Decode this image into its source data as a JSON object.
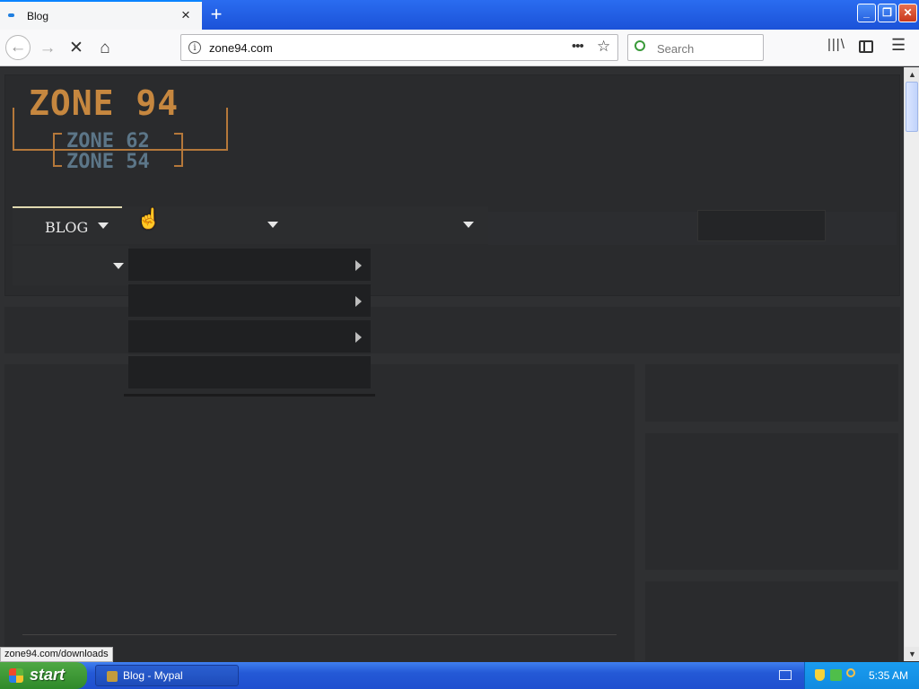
{
  "browser": {
    "tab_title": "Blog",
    "new_tab_symbol": "+",
    "close_tab_symbol": "×",
    "url": "zone94.com",
    "url_info_symbol": "i",
    "url_more_symbol": "•••",
    "bookmark_symbol": "☆",
    "search_placeholder": "Search",
    "library_symbol": "|||\\",
    "menu_symbol": "☰",
    "nav": {
      "back": "←",
      "forward": "→",
      "stop": "✕",
      "home": "⌂"
    },
    "window_controls": {
      "minimize": "_",
      "maximize": "❐",
      "close": "✕"
    }
  },
  "site": {
    "logo": {
      "main": "ZONE 94",
      "sub1": "ZONE 62",
      "sub2": "ZONE 54"
    },
    "nav": {
      "blog_label": "BLOG"
    }
  },
  "status_url": "zone94.com/downloads",
  "scrollbar": {
    "up": "▲",
    "down": "▼"
  },
  "taskbar": {
    "start_label": "start",
    "task_label": "Blog - Mypal",
    "clock": "5:35 AM"
  },
  "colors": {
    "page_bg": "#2f3032",
    "logo_orange": "#c6873f",
    "logo_steel": "#5c7688",
    "taskbar_blue": "#2459d6",
    "start_green": "#3f9b38"
  }
}
